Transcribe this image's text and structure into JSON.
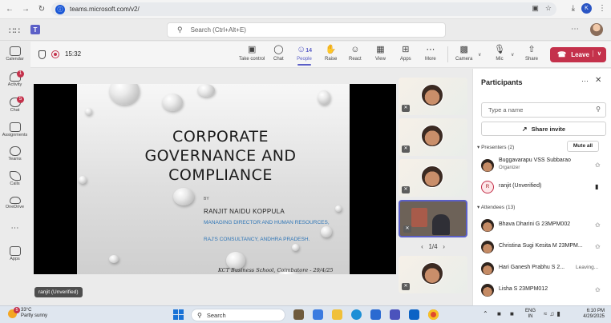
{
  "browser": {
    "url": "teams.microsoft.com/v2/",
    "profile_initial": "K"
  },
  "teams": {
    "search_placeholder": "Search (Ctrl+Alt+E)"
  },
  "rail": [
    {
      "label": "Calendar",
      "badge": ""
    },
    {
      "label": "Activity",
      "badge": "1"
    },
    {
      "label": "Chat",
      "badge": "5"
    },
    {
      "label": "Assignments",
      "badge": ""
    },
    {
      "label": "Teams",
      "badge": ""
    },
    {
      "label": "Calls",
      "badge": ""
    },
    {
      "label": "OneDrive",
      "badge": ""
    },
    {
      "label": "Apps",
      "badge": ""
    }
  ],
  "meeting": {
    "timer": "15:32",
    "controls": {
      "take_control": "Take control",
      "chat": "Chat",
      "people": "People",
      "people_count": "14",
      "raise": "Raise",
      "react": "React",
      "view": "View",
      "apps": "Apps",
      "more": "More",
      "camera": "Camera",
      "mic": "Mic",
      "share": "Share",
      "leave": "Leave"
    }
  },
  "slide": {
    "title_line1": "CORPORATE",
    "title_line2": "GOVERNANCE AND",
    "title_line3": "COMPLIANCE",
    "by": "BY",
    "presenter": "RANJIT NAIDU KOPPULA",
    "role": "MANAGING DIRECTOR AND HUMAN RESOURCES,",
    "consultancy": "RAJ'S CONSULTANCY, ANDHRA PRADESH.",
    "handwritten": "KCT Business School, Coimbatore - 29/4/25"
  },
  "stage": {
    "name_tag": "ranjit (Unverified)",
    "pager": "1/4"
  },
  "participants": {
    "title": "Participants",
    "search_placeholder": "Type a name",
    "share_invite": "Share invite",
    "presenters_label": "Presenters (2)",
    "mute_all": "Mute all",
    "presenters": [
      {
        "name": "Buggavarapu VSS Subbarao",
        "sub": "Organizer",
        "initial": ""
      },
      {
        "name": "ranjit (Unverified)",
        "sub": "",
        "initial": "R"
      }
    ],
    "attendees_label": "Attendees (13)",
    "attendees": [
      {
        "name": "Bhava Dharini G 23MPM002",
        "status": ""
      },
      {
        "name": "Christina Sugi Kesita M 23MPM...",
        "status": ""
      },
      {
        "name": "Hari Ganesh Prabhu S 2...",
        "status": "Leaving..."
      },
      {
        "name": "Lisha S 23MPM012",
        "status": ""
      }
    ]
  },
  "taskbar": {
    "temp": "33°C",
    "weather": "Partly sunny",
    "weather_badge": "5",
    "search": "Search",
    "lang1": "ENG",
    "lang2": "IN",
    "time": "6:10 PM",
    "date": "4/29/2025"
  },
  "colors": {
    "accent": "#5b5fc7",
    "leave": "#c4314b",
    "link_blue": "#2e75b6"
  }
}
